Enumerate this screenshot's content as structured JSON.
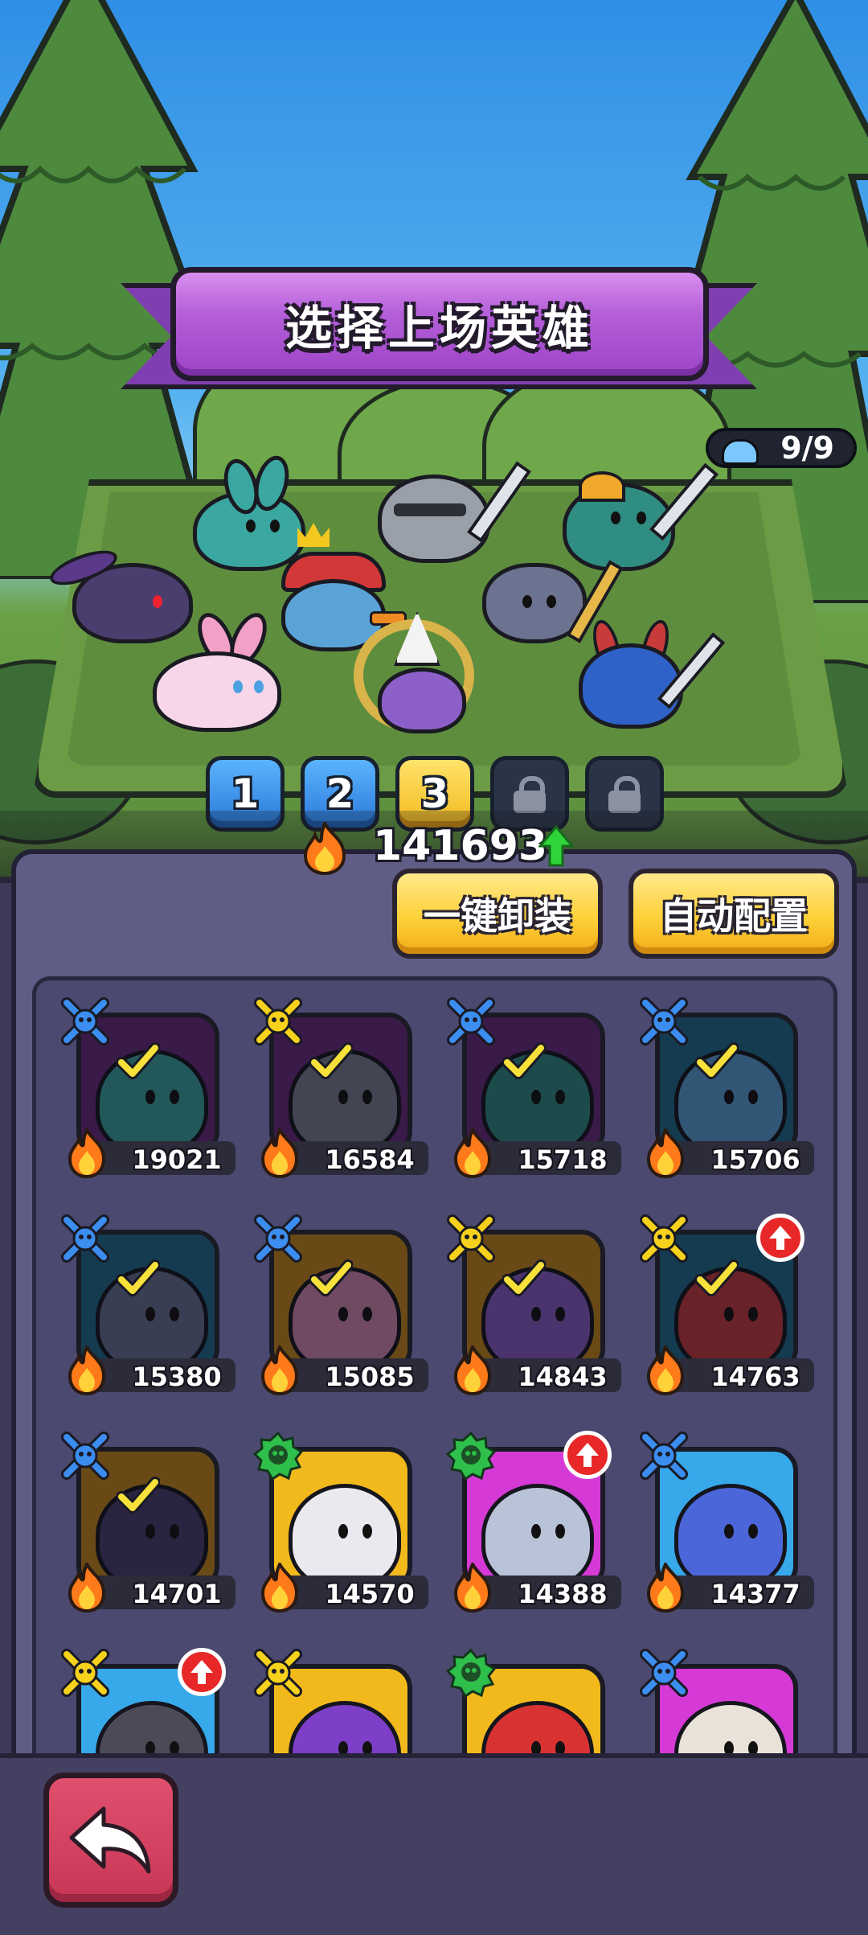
{
  "header": {
    "title": "选择上场英雄",
    "hero_count": "9/9"
  },
  "team_tabs": [
    {
      "label": "1",
      "state": "available",
      "color": "#2a78d8"
    },
    {
      "label": "2",
      "state": "available",
      "color": "#2a78d8"
    },
    {
      "label": "3",
      "state": "selected",
      "color": "#f2b91d"
    },
    {
      "label": "",
      "state": "locked",
      "icon": "lock-icon"
    },
    {
      "label": "",
      "state": "locked",
      "icon": "lock-icon"
    }
  ],
  "total_power": {
    "value": "141693",
    "trend_icon": "green-up-arrow-icon"
  },
  "buttons": {
    "unequip_all": "一键卸装",
    "auto_config": "自动配置"
  },
  "heroes": [
    {
      "power": "19021",
      "rank": "blue",
      "equipped": true,
      "upgrade": false,
      "bg": "#6a2b7d",
      "char": "#3aa7a0",
      "name": "bunny"
    },
    {
      "power": "16584",
      "rank": "gold",
      "equipped": true,
      "upgrade": false,
      "bg": "#6a2b7d",
      "char": "#7d8390",
      "name": "knight"
    },
    {
      "power": "15718",
      "rank": "blue",
      "equipped": true,
      "upgrade": false,
      "bg": "#6a2b7d",
      "char": "#2f8d82",
      "name": "dino"
    },
    {
      "power": "15706",
      "rank": "blue",
      "equipped": true,
      "upgrade": false,
      "bg": "#1e6d8d",
      "char": "#5aa3d6",
      "name": "snowman"
    },
    {
      "power": "15380",
      "rank": "blue",
      "equipped": true,
      "upgrade": false,
      "bg": "#1e6d8d",
      "char": "#6b7390",
      "name": "cloud"
    },
    {
      "power": "15085",
      "rank": "blue",
      "equipped": true,
      "upgrade": false,
      "bg": "#c98a1a",
      "char": "#d78ab0",
      "name": "pink-bunny"
    },
    {
      "power": "14843",
      "rank": "gold",
      "equipped": true,
      "upgrade": false,
      "bg": "#c98a1a",
      "char": "#8d5fc8",
      "name": "priest"
    },
    {
      "power": "14763",
      "rank": "gold",
      "equipped": true,
      "upgrade": true,
      "bg": "#1e6d8d",
      "char": "#c93b3b",
      "name": "red-warrior"
    },
    {
      "power": "14701",
      "rank": "blue",
      "equipped": true,
      "upgrade": false,
      "bg": "#c98a1a",
      "char": "#4a3e6e",
      "name": "dark-elf"
    },
    {
      "power": "14570",
      "rank": "green",
      "equipped": false,
      "upgrade": false,
      "bg": "#f2b91d",
      "char": "#e9e9ef",
      "name": "ultra-hero"
    },
    {
      "power": "14388",
      "rank": "green",
      "equipped": false,
      "upgrade": true,
      "bg": "#d63ad6",
      "char": "#b9c3d8",
      "name": "mech"
    },
    {
      "power": "14377",
      "rank": "blue",
      "equipped": false,
      "upgrade": false,
      "bg": "#37a8ea",
      "char": "#4a66d8",
      "name": "spike-slime"
    },
    {
      "power": "",
      "rank": "gold",
      "equipped": false,
      "upgrade": true,
      "bg": "#37a8ea",
      "char": "#4d4a58",
      "name": "wolf"
    },
    {
      "power": "",
      "rank": "gold",
      "equipped": false,
      "upgrade": false,
      "bg": "#f2b91d",
      "char": "#7d3fc8",
      "name": "armor"
    },
    {
      "power": "",
      "rank": "green",
      "equipped": false,
      "upgrade": false,
      "bg": "#f2b91d",
      "char": "#d83232",
      "name": "red-mech"
    },
    {
      "power": "",
      "rank": "blue",
      "equipped": false,
      "upgrade": false,
      "bg": "#d63ad6",
      "char": "#e8e2d8",
      "name": "mummy"
    }
  ],
  "colors": {
    "rank_blue": "#3c8df0",
    "rank_gold": "#f7d21c",
    "rank_green": "#2fbf4b",
    "accent_purple": "#b45ed8",
    "back_button": "#c83656"
  }
}
